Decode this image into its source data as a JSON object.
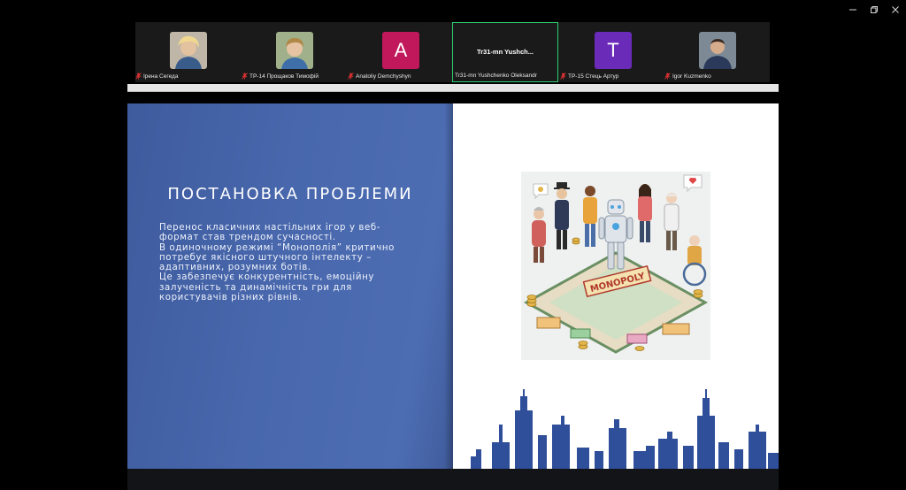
{
  "participants": [
    {
      "name": "Ірена Сегеда",
      "muted": true,
      "avatar": "photo",
      "avatar_color": "#d9b48a"
    },
    {
      "name": "ТР-14 Прощаков Тимофій",
      "muted": true,
      "avatar": "photo",
      "avatar_color": "#c9a27a"
    },
    {
      "name": "Anatoliy Demchyshyn",
      "muted": true,
      "avatar": "letter",
      "letter": "A",
      "avatar_color": "#c0185b"
    },
    {
      "name": "Tr31-mn Yushchenko Oleksandr",
      "muted": false,
      "avatar": "none",
      "short_label": "Tr31-mn Yushch...",
      "active": true
    },
    {
      "name": "ТР-15 Стець Артур",
      "muted": true,
      "avatar": "letter",
      "letter": "T",
      "avatar_color": "#6a2bb8"
    },
    {
      "name": "Igor Kuzmenko",
      "muted": true,
      "avatar": "photo",
      "avatar_color": "#8c7a6a"
    }
  ],
  "slide": {
    "title": "ПОСТАНОВКА ПРОБЛЕМИ",
    "lines": [
      "Перенос класичних настільних ігор у веб-",
      "формат став трендом сучасності.",
      "В одиночному режимі “Монополія” критично",
      "потребує якісного штучного інтелекту –",
      "адаптивних, розумних ботів.",
      "Це забезпечує конкурентність, емоційну",
      "залученість та динамічність гри для",
      "користувачів різних рівнів."
    ],
    "image_label": "MONOPOLY",
    "left_color": "#4867ac",
    "skyline_color": "#2f4f9a"
  },
  "window": {
    "minimize": "minimize-icon",
    "restore": "restore-icon",
    "close": "close-icon"
  }
}
